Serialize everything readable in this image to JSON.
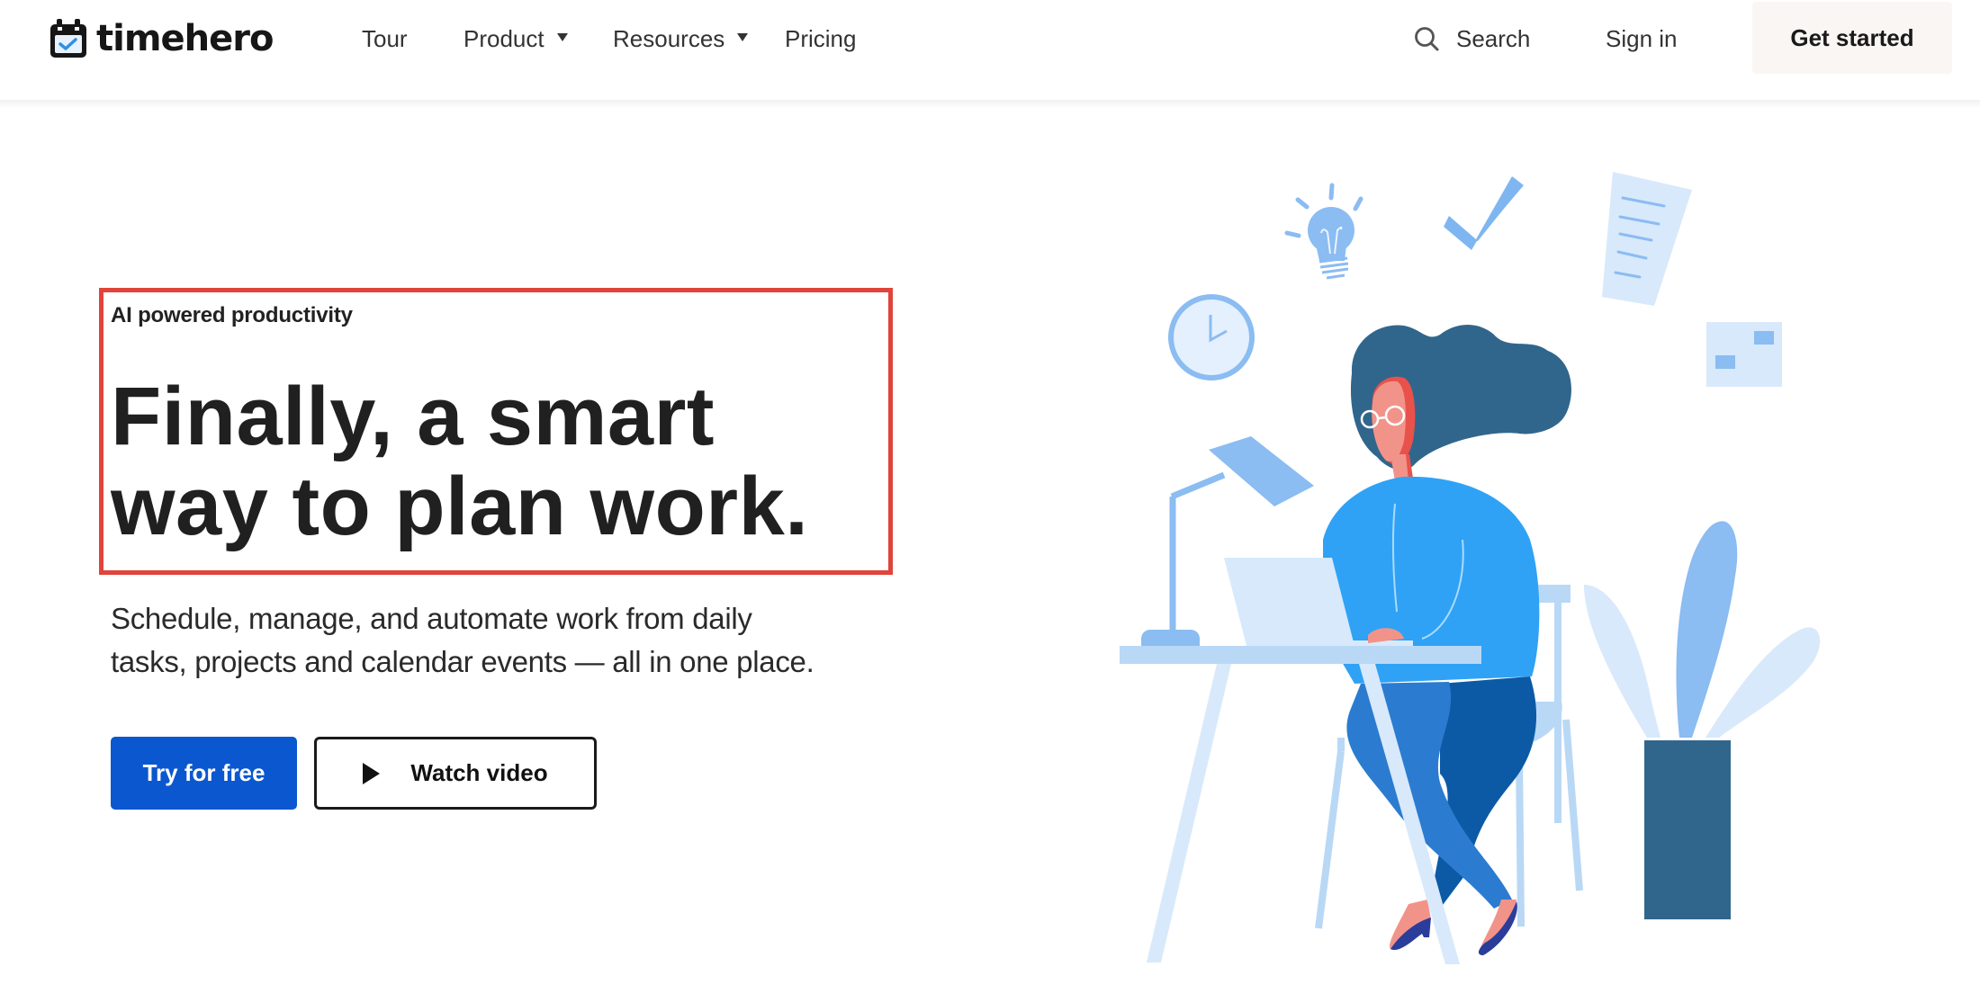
{
  "header": {
    "logo": {
      "text": "timehero",
      "icon": "calendar-check-icon"
    },
    "nav": [
      {
        "label": "Tour",
        "has_dropdown": false
      },
      {
        "label": "Product",
        "has_dropdown": true
      },
      {
        "label": "Resources",
        "has_dropdown": true
      },
      {
        "label": "Pricing",
        "has_dropdown": false
      }
    ],
    "search": {
      "label": "Search",
      "icon": "search-icon"
    },
    "sign_in": "Sign in",
    "get_started": "Get started"
  },
  "hero": {
    "eyebrow": "AI powered productivity",
    "headline_line1": "Finally, a smart",
    "headline_line2": "way to plan work.",
    "subtext_line1": "Schedule, manage, and automate work from daily",
    "subtext_line2": "tasks, projects and calendar events — all in one place.",
    "primary_cta": "Try for free",
    "secondary_cta": {
      "label": "Watch video",
      "icon": "play-icon"
    },
    "highlight_color": "#e0443a"
  },
  "illustration": {
    "description": "Woman working at laptop on desk with lamp, plant, clock, lightbulb, checkmark, document and note icons",
    "colors": {
      "primary_blue": "#2fa2f5",
      "light_blue": "#d5e8fb",
      "mid_blue": "#8bbcf2",
      "dark_teal": "#31668c",
      "skin": "#f2938a",
      "brand_cta": "#0b57d0"
    }
  }
}
